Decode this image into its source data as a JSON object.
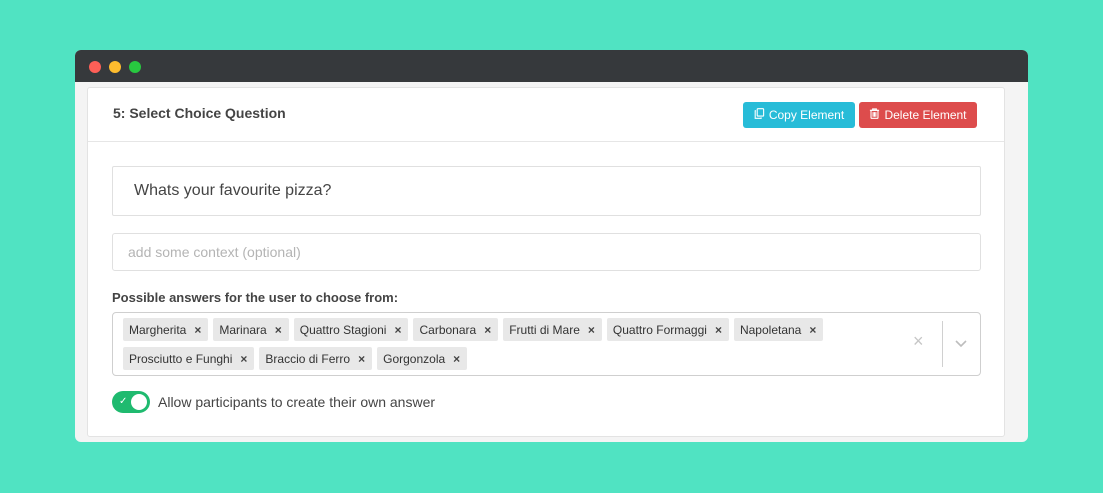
{
  "card": {
    "title": "5: Select Choice Question",
    "copy_label": "Copy Element",
    "delete_label": "Delete Element"
  },
  "question": {
    "value": "Whats your favourite pizza?"
  },
  "context": {
    "placeholder": "add some context (optional)"
  },
  "answers": {
    "label": "Possible answers for the user to choose from:",
    "options": [
      "Margherita",
      "Marinara",
      "Quattro Stagioni",
      "Carbonara",
      "Frutti di Mare",
      "Quattro Formaggi",
      "Napoletana",
      "Prosciutto e Funghi",
      "Braccio di Ferro",
      "Gorgonzola"
    ],
    "remove_glyph": "×",
    "clear_glyph": "×"
  },
  "toggle": {
    "checked": true,
    "check_glyph": "✓",
    "label": "Allow participants to create their own answer"
  },
  "colors": {
    "background": "#50e3c2",
    "copy_button": "#27bcd8",
    "delete_button": "#dd4c4c",
    "toggle_on": "#1fba6f"
  },
  "icons": {
    "copy": "copy-icon",
    "delete": "trash-icon",
    "dropdown": "chevron-down-icon"
  }
}
